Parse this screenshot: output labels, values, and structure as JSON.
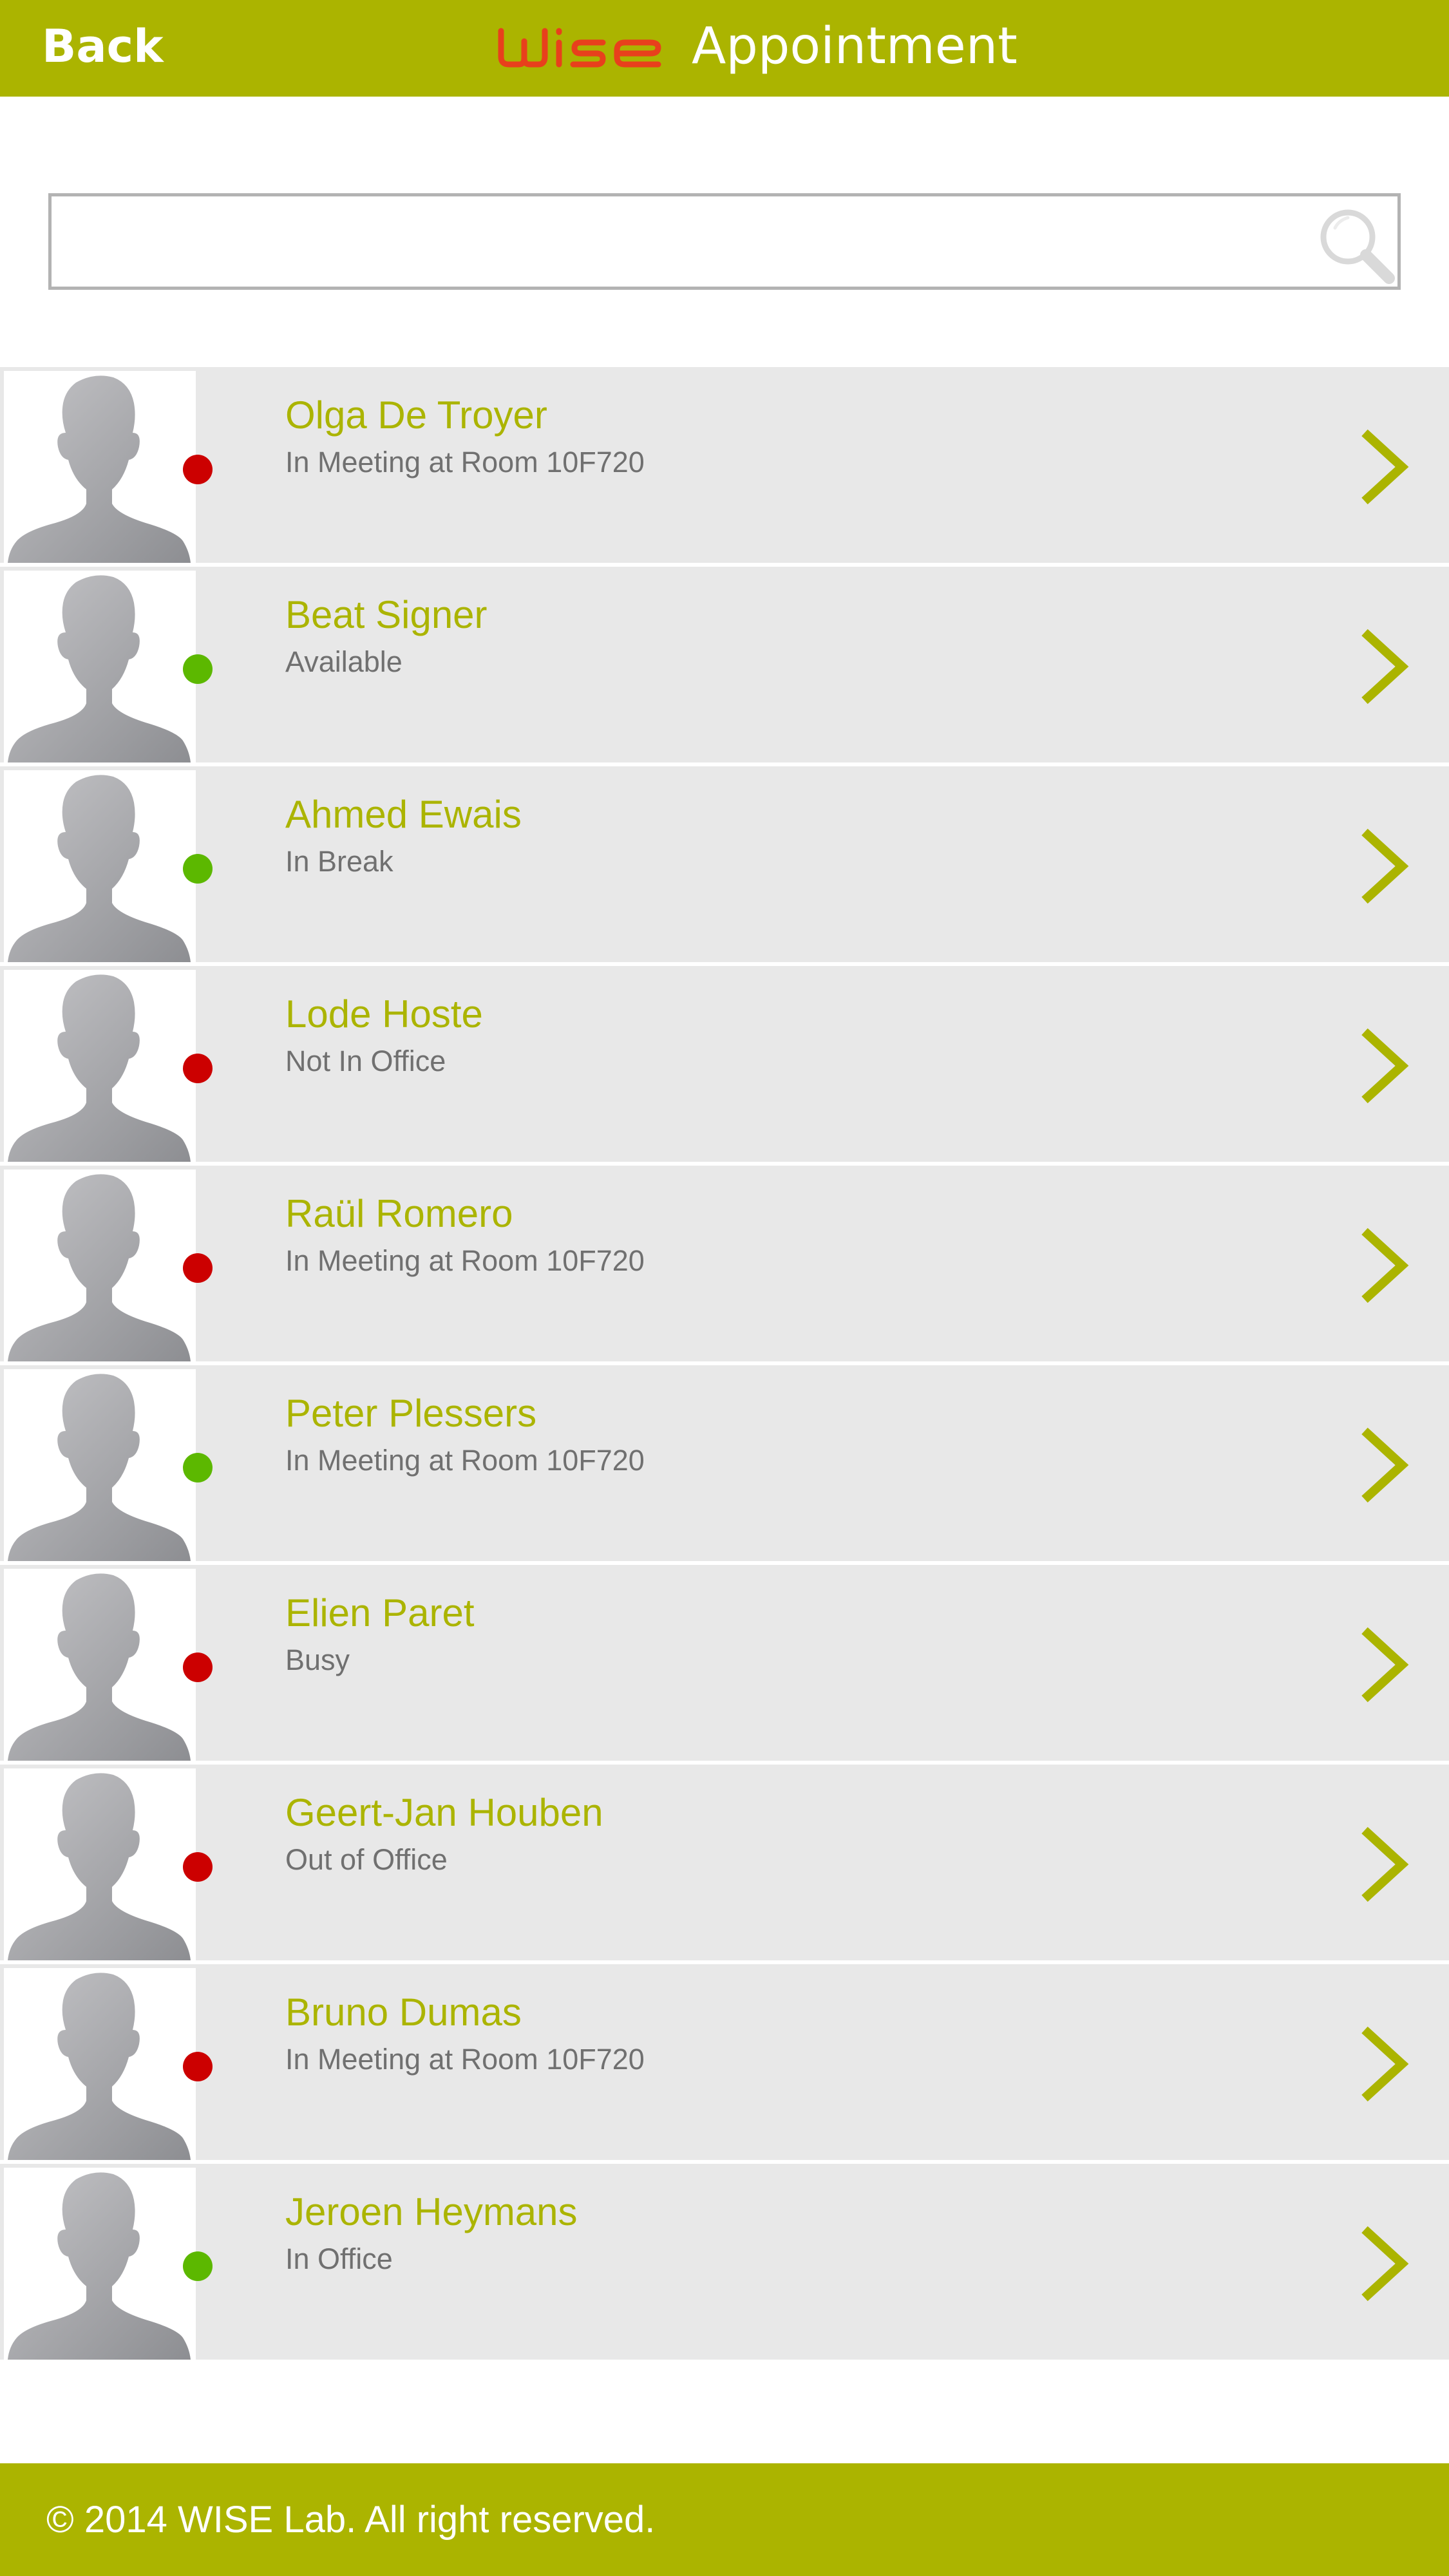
{
  "header": {
    "back_label": "Back",
    "logo_text": "WISE",
    "title": "Appointment"
  },
  "search": {
    "value": "",
    "placeholder": "",
    "icon": "search-icon"
  },
  "contacts": [
    {
      "name": "Olga De Troyer",
      "status": "In Meeting at Room 10F720",
      "presence": "busy"
    },
    {
      "name": "Beat Signer",
      "status": "Available",
      "presence": "available"
    },
    {
      "name": "Ahmed Ewais",
      "status": "In Break",
      "presence": "available"
    },
    {
      "name": "Lode Hoste",
      "status": "Not In Office",
      "presence": "busy"
    },
    {
      "name": "Raül Romero",
      "status": "In Meeting at Room 10F720",
      "presence": "busy"
    },
    {
      "name": "Peter Plessers",
      "status": "In Meeting at Room 10F720",
      "presence": "available"
    },
    {
      "name": "Elien Paret",
      "status": "Busy",
      "presence": "busy"
    },
    {
      "name": "Geert-Jan Houben",
      "status": "Out of Office",
      "presence": "busy"
    },
    {
      "name": "Bruno Dumas",
      "status": "In Meeting at Room 10F720",
      "presence": "busy"
    },
    {
      "name": "Jeroen Heymans",
      "status": "In Office",
      "presence": "available"
    }
  ],
  "footer": {
    "copyright": "© 2014 WISE Lab. All right reserved."
  },
  "colors": {
    "accent": "#abb400",
    "logo": "#e8401c",
    "available": "#5cb800",
    "busy": "#cc0000",
    "row_background": "#e8e8e8"
  }
}
